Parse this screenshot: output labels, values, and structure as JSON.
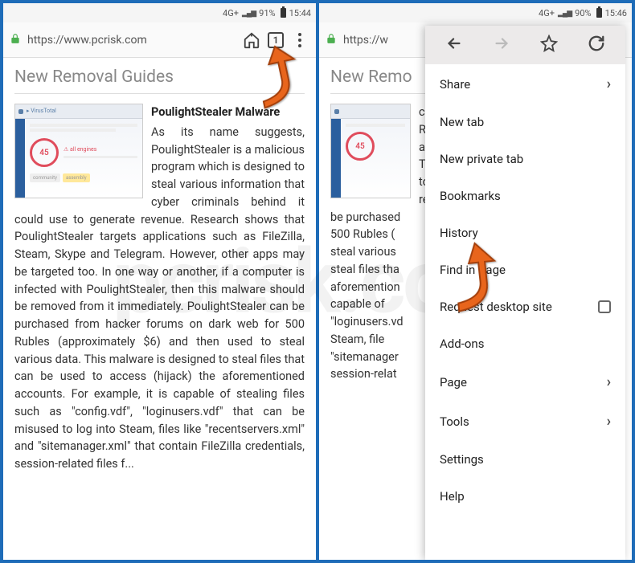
{
  "status": {
    "net_label": "4G+",
    "battery_pct_left": "91%",
    "time_left": "15:44",
    "battery_pct_right": "90%",
    "time_right": "15:46"
  },
  "browser": {
    "url": "https://www.pcrisk.com",
    "url_truncated": "https://w",
    "tab_count": "1"
  },
  "page": {
    "title": "New Removal Guides",
    "title_truncated": "New Remo"
  },
  "article": {
    "title": "PoulightStealer Malware",
    "thumb_score": "45",
    "body": "As its name suggests, PoulightStealer is a malicious program which is designed to steal various information that cyber criminals behind it could use to generate revenue. Research shows that PoulightStealer targets applications such as FileZilla, Steam, Skype and Telegram. However, other apps may be targeted too. In one way or another, if a computer is infected with PoulightStealer, then this malware should be removed from it immediately. PoulightStealer can be purchased from hacker forums on dark web for 500 Rubles (approximately $6) and then used to steal various data. This malware is designed to steal files that can be used to access (hijack) the aforementioned accounts. For example, it is capable of stealing files such as \"config.vdf\", \"loginusers.vdf\" that can be misused to log into Steam, files like \"recentservers.xml\" and \"sitemanager.xml\" that contain FileZilla credentials, session-related files f...",
    "body_truncated_lines": [
      "criminals beh",
      "Research sl",
      "applications",
      "Telegram. Ho",
      "too. In one w",
      "removed fron",
      "be purchased",
      "500 Rubles (",
      "steal various",
      "steal files tha",
      "aforemention",
      "capable of",
      "\"loginusers.vd",
      "Steam, file",
      "\"sitemanager",
      "session-relat"
    ]
  },
  "menu": {
    "items": [
      {
        "label": "Share",
        "chevron": true
      },
      {
        "label": "New tab"
      },
      {
        "label": "New private tab"
      },
      {
        "label": "Bookmarks"
      },
      {
        "label": "History"
      },
      {
        "label": "Find in Page"
      },
      {
        "label": "Request desktop site",
        "checkbox": true
      },
      {
        "label": "Add-ons"
      },
      {
        "label": "Page",
        "chevron": true
      },
      {
        "label": "Tools",
        "chevron": true
      },
      {
        "label": "Settings"
      },
      {
        "label": "Help"
      }
    ]
  },
  "watermark": "pcrisk.com"
}
